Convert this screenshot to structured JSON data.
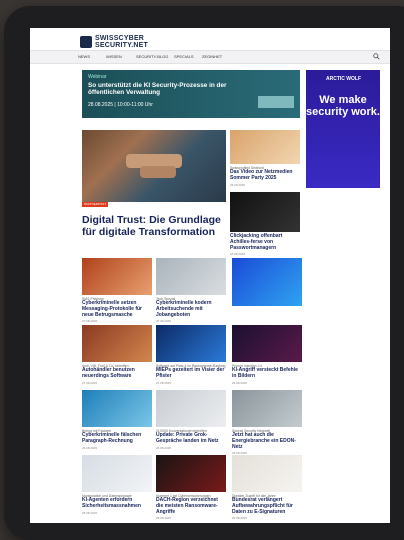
{
  "site": {
    "logo_line1": "SWISSCYBER",
    "logo_line2": "SECURITY.NET"
  },
  "nav": {
    "items": [
      "NEWS",
      "WISSEN",
      "SECURITY-BLOG",
      "SPECIALS",
      "ZEGINHET"
    ]
  },
  "banner": {
    "eyebrow": "Webinar",
    "title": "So unterstützt die KI Security-Prozesse in der öffentlichen Verwaltung",
    "date": "28.08.2025 | 10:00-11:00 Uhr"
  },
  "ad": {
    "brand": "ARCTIC WOLF",
    "title": "We make security work."
  },
  "hero": {
    "badge": "PARTNERPOST",
    "title": "Digital Trust: Die Grundlage für digitale Transformation",
    "date": "27.08.2025"
  },
  "side_articles": [
    {
      "kicker": "Swissprofiled Seabord",
      "title": "Das Video zur Netzmedien Sommer Party 2025",
      "date": "25.08.2025"
    },
    {
      "kicker": "",
      "title": "Clickjacking offenbart Achilles-ferse von Passwortmanagern",
      "date": "26.08.2025"
    },
    {
      "kicker": "",
      "title": "",
      "date": ""
    }
  ],
  "cards_row1": [
    {
      "kicker": "SMS-Phishing",
      "title": "Cyberkriminelle setzen Messaging-Protokolle für neue Betrugsmasche",
      "date": "27.08.2025"
    },
    {
      "kicker": "Tech Spezial",
      "title": "Cyberkriminelle kodern Arbeitsuchende mit Jobangeboten",
      "date": "27.08.2025"
    }
  ],
  "cards_row2": [
    {
      "kicker": "Audi, VW, Ford & Co. betroffen",
      "title": "Autohändler benutzen neuerdings Software",
      "date": "27.08.2025"
    },
    {
      "kicker": "Software auf Platz 4 im Ransomware-Ranking",
      "title": "MIEPs gezeitert im Visier der Pfister",
      "date": "27.08.2025"
    },
    {
      "kicker": "Prompt Injection 2.0",
      "title": "KI-Angriff versteckt Befehle in Bildern",
      "date": "26.08.2025"
    }
  ],
  "cards_row3": [
    {
      "kicker": "Betrug mit Fastweb",
      "title": "Cyberkriminelle fälschen Paragraph-Rechnung",
      "date": "26.08.2025"
    },
    {
      "kicker": "210'000 Konversationen betroffen",
      "title": "Update: Private Grok-Gespräche landen im Netz",
      "date": "26.08.2025"
    },
    {
      "kicker": "Spezial Security Netzwelt",
      "title": "Jetzt hat auch die Energiebranche ein EDON-Netz",
      "date": "26.08.2025"
    }
  ],
  "cards_row4": [
    {
      "kicker": "Manipulation und Datenspionage",
      "title": "KI-Agenten erfordern Sicherheitsmassnahmen",
      "date": "25.08.2025"
    },
    {
      "kicker": "Nummer 1 bei Cyberversicherungen",
      "title": "DACH-Region verzeichnet die meisten Ransomware-Angriffe",
      "date": "25.08.2025"
    },
    {
      "kicker": "Digitaler Zugriff für alle Jahre",
      "title": "Bundesrat verlängert Aufbewahrungspflicht für Daten zu E-Signaturen",
      "date": "22.08.2025"
    }
  ],
  "colors": {
    "accent": "#17235a",
    "badge": "#e03a1e",
    "banner": "#1c4f57",
    "ad": "#2b1b9a"
  }
}
